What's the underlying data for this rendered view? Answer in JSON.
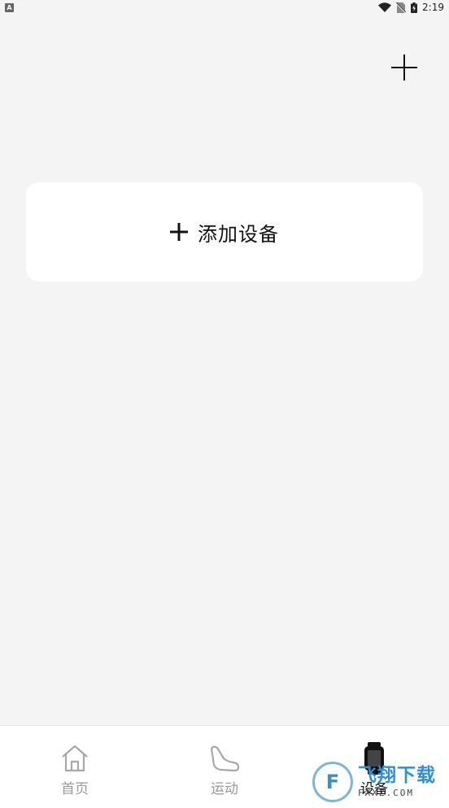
{
  "status_bar": {
    "notification_icon": "A",
    "time": "2:19",
    "icons": [
      "wifi-icon",
      "no-sim-icon",
      "battery-charging-icon"
    ]
  },
  "header": {
    "add_icon": "plus-icon"
  },
  "add_device_card": {
    "icon": "plus-icon",
    "label": "添加设备"
  },
  "tab_bar": {
    "tabs": [
      {
        "label": "首页",
        "icon": "home-icon",
        "active": false
      },
      {
        "label": "运动",
        "icon": "shoe-icon",
        "active": false
      },
      {
        "label": "设备",
        "icon": "watch-icon",
        "active": true
      }
    ]
  },
  "watermark": {
    "logo_letter": "F",
    "title": "飞翔下载",
    "subtitle": "FXXZ.COM"
  },
  "colors": {
    "background": "#f4f4f4",
    "card": "#ffffff",
    "tab_inactive": "#9a9a9a",
    "tab_active": "#111111",
    "watermark_blue": "#2f8fd8"
  }
}
